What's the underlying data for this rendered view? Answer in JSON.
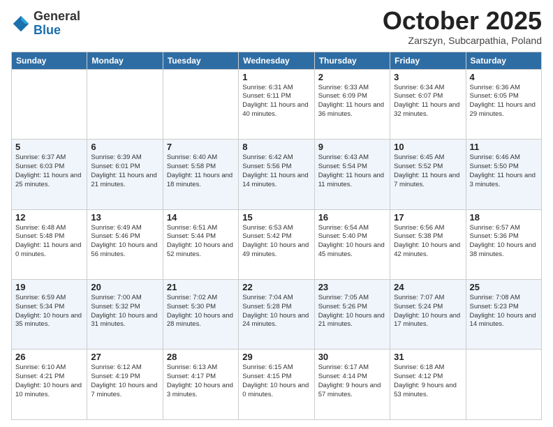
{
  "header": {
    "logo_general": "General",
    "logo_blue": "Blue",
    "month": "October 2025",
    "location": "Zarszyn, Subcarpathia, Poland"
  },
  "days_of_week": [
    "Sunday",
    "Monday",
    "Tuesday",
    "Wednesday",
    "Thursday",
    "Friday",
    "Saturday"
  ],
  "weeks": [
    [
      {
        "day": "",
        "info": ""
      },
      {
        "day": "",
        "info": ""
      },
      {
        "day": "",
        "info": ""
      },
      {
        "day": "1",
        "info": "Sunrise: 6:31 AM\nSunset: 6:11 PM\nDaylight: 11 hours\nand 40 minutes."
      },
      {
        "day": "2",
        "info": "Sunrise: 6:33 AM\nSunset: 6:09 PM\nDaylight: 11 hours\nand 36 minutes."
      },
      {
        "day": "3",
        "info": "Sunrise: 6:34 AM\nSunset: 6:07 PM\nDaylight: 11 hours\nand 32 minutes."
      },
      {
        "day": "4",
        "info": "Sunrise: 6:36 AM\nSunset: 6:05 PM\nDaylight: 11 hours\nand 29 minutes."
      }
    ],
    [
      {
        "day": "5",
        "info": "Sunrise: 6:37 AM\nSunset: 6:03 PM\nDaylight: 11 hours\nand 25 minutes."
      },
      {
        "day": "6",
        "info": "Sunrise: 6:39 AM\nSunset: 6:01 PM\nDaylight: 11 hours\nand 21 minutes."
      },
      {
        "day": "7",
        "info": "Sunrise: 6:40 AM\nSunset: 5:58 PM\nDaylight: 11 hours\nand 18 minutes."
      },
      {
        "day": "8",
        "info": "Sunrise: 6:42 AM\nSunset: 5:56 PM\nDaylight: 11 hours\nand 14 minutes."
      },
      {
        "day": "9",
        "info": "Sunrise: 6:43 AM\nSunset: 5:54 PM\nDaylight: 11 hours\nand 11 minutes."
      },
      {
        "day": "10",
        "info": "Sunrise: 6:45 AM\nSunset: 5:52 PM\nDaylight: 11 hours\nand 7 minutes."
      },
      {
        "day": "11",
        "info": "Sunrise: 6:46 AM\nSunset: 5:50 PM\nDaylight: 11 hours\nand 3 minutes."
      }
    ],
    [
      {
        "day": "12",
        "info": "Sunrise: 6:48 AM\nSunset: 5:48 PM\nDaylight: 11 hours\nand 0 minutes."
      },
      {
        "day": "13",
        "info": "Sunrise: 6:49 AM\nSunset: 5:46 PM\nDaylight: 10 hours\nand 56 minutes."
      },
      {
        "day": "14",
        "info": "Sunrise: 6:51 AM\nSunset: 5:44 PM\nDaylight: 10 hours\nand 52 minutes."
      },
      {
        "day": "15",
        "info": "Sunrise: 6:53 AM\nSunset: 5:42 PM\nDaylight: 10 hours\nand 49 minutes."
      },
      {
        "day": "16",
        "info": "Sunrise: 6:54 AM\nSunset: 5:40 PM\nDaylight: 10 hours\nand 45 minutes."
      },
      {
        "day": "17",
        "info": "Sunrise: 6:56 AM\nSunset: 5:38 PM\nDaylight: 10 hours\nand 42 minutes."
      },
      {
        "day": "18",
        "info": "Sunrise: 6:57 AM\nSunset: 5:36 PM\nDaylight: 10 hours\nand 38 minutes."
      }
    ],
    [
      {
        "day": "19",
        "info": "Sunrise: 6:59 AM\nSunset: 5:34 PM\nDaylight: 10 hours\nand 35 minutes."
      },
      {
        "day": "20",
        "info": "Sunrise: 7:00 AM\nSunset: 5:32 PM\nDaylight: 10 hours\nand 31 minutes."
      },
      {
        "day": "21",
        "info": "Sunrise: 7:02 AM\nSunset: 5:30 PM\nDaylight: 10 hours\nand 28 minutes."
      },
      {
        "day": "22",
        "info": "Sunrise: 7:04 AM\nSunset: 5:28 PM\nDaylight: 10 hours\nand 24 minutes."
      },
      {
        "day": "23",
        "info": "Sunrise: 7:05 AM\nSunset: 5:26 PM\nDaylight: 10 hours\nand 21 minutes."
      },
      {
        "day": "24",
        "info": "Sunrise: 7:07 AM\nSunset: 5:24 PM\nDaylight: 10 hours\nand 17 minutes."
      },
      {
        "day": "25",
        "info": "Sunrise: 7:08 AM\nSunset: 5:23 PM\nDaylight: 10 hours\nand 14 minutes."
      }
    ],
    [
      {
        "day": "26",
        "info": "Sunrise: 6:10 AM\nSunset: 4:21 PM\nDaylight: 10 hours\nand 10 minutes."
      },
      {
        "day": "27",
        "info": "Sunrise: 6:12 AM\nSunset: 4:19 PM\nDaylight: 10 hours\nand 7 minutes."
      },
      {
        "day": "28",
        "info": "Sunrise: 6:13 AM\nSunset: 4:17 PM\nDaylight: 10 hours\nand 3 minutes."
      },
      {
        "day": "29",
        "info": "Sunrise: 6:15 AM\nSunset: 4:15 PM\nDaylight: 10 hours\nand 0 minutes."
      },
      {
        "day": "30",
        "info": "Sunrise: 6:17 AM\nSunset: 4:14 PM\nDaylight: 9 hours\nand 57 minutes."
      },
      {
        "day": "31",
        "info": "Sunrise: 6:18 AM\nSunset: 4:12 PM\nDaylight: 9 hours\nand 53 minutes."
      },
      {
        "day": "",
        "info": ""
      }
    ]
  ]
}
